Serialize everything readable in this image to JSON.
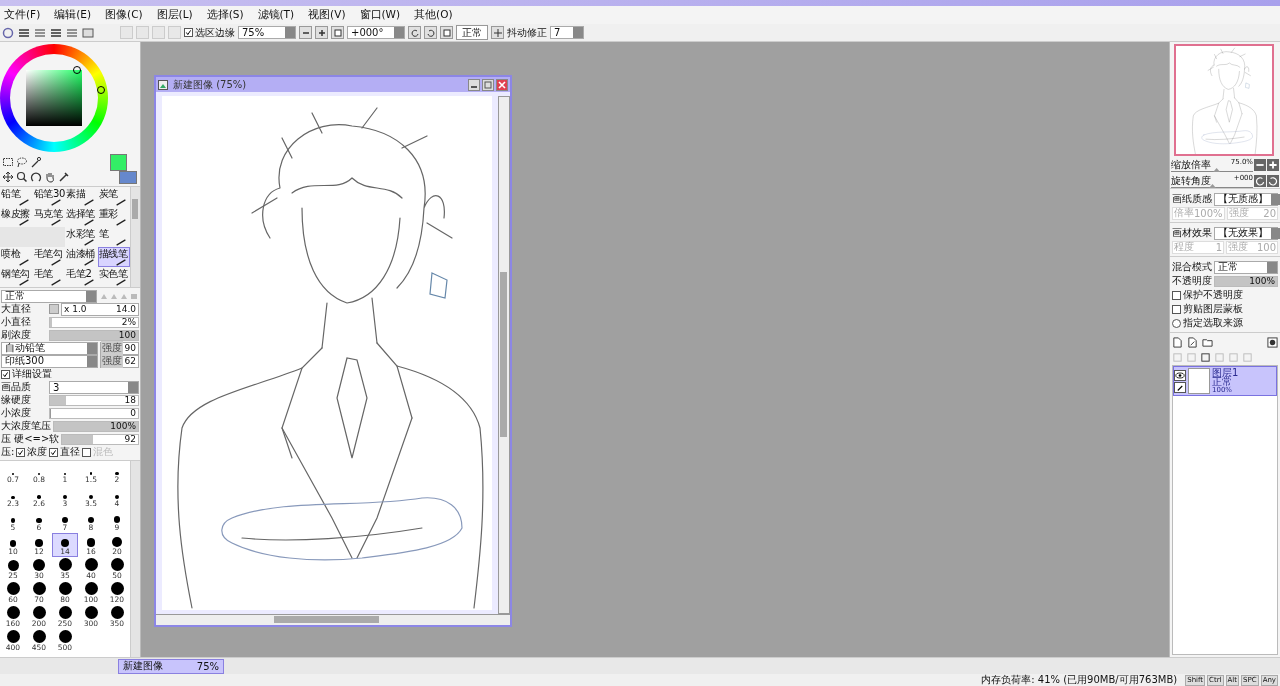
{
  "menu": [
    "文件(F)",
    "编辑(E)",
    "图像(C)",
    "图层(L)",
    "选择(S)",
    "滤镜(T)",
    "视图(V)",
    "窗口(W)",
    "其他(O)"
  ],
  "toolbar": {
    "selection_edge": {
      "label": "选区边缘",
      "checked": true
    },
    "zoom": "75%",
    "rotation": "+000°",
    "blend_mode": "正常",
    "stabilizer": {
      "label": "抖动修正",
      "value": "7"
    }
  },
  "swatches": [
    {
      "kind": "foreground",
      "color": "#33ee66"
    },
    {
      "kind": "background",
      "color": "#6688cc"
    }
  ],
  "brushes": [
    {
      "kind": "tool",
      "label": "铅笔",
      "selected": false
    },
    {
      "kind": "tool",
      "label": "铅笔30",
      "selected": false
    },
    {
      "kind": "tool",
      "label": "素描",
      "selected": false
    },
    {
      "kind": "tool",
      "label": "炭笔",
      "selected": false
    },
    {
      "kind": "tool",
      "label": "橡皮擦",
      "selected": false
    },
    {
      "kind": "tool",
      "label": "马克笔",
      "selected": false
    },
    {
      "kind": "tool",
      "label": "选择笔",
      "selected": false
    },
    {
      "kind": "tool",
      "label": "重彩",
      "selected": false
    },
    {
      "kind": "empty"
    },
    {
      "kind": "empty"
    },
    {
      "kind": "tool",
      "label": "水彩笔",
      "selected": false
    },
    {
      "kind": "tool",
      "label": "笔",
      "selected": false
    },
    {
      "kind": "tool",
      "label": "喷枪",
      "selected": false
    },
    {
      "kind": "tool",
      "label": "毛笔勾",
      "selected": false
    },
    {
      "kind": "tool",
      "label": "油漆桶",
      "selected": false
    },
    {
      "kind": "tool",
      "label": "描线笔",
      "selected": true
    },
    {
      "kind": "tool",
      "label": "钢笔勾",
      "selected": false
    },
    {
      "kind": "tool",
      "label": "毛笔",
      "selected": false
    },
    {
      "kind": "tool",
      "label": "毛笔2",
      "selected": false
    },
    {
      "kind": "tool",
      "label": "实色笔",
      "selected": false
    }
  ],
  "brush_settings": {
    "mode": "正常",
    "rows": [
      {
        "kind": "size",
        "label": "大直径",
        "multiplier": "x 1.0",
        "value": "14.0"
      },
      {
        "kind": "slider",
        "label": "小直径",
        "value": "2%",
        "level": 0.02
      },
      {
        "kind": "slider",
        "label": "刷浓度",
        "value": "100",
        "level": 1
      },
      {
        "kind": "texture",
        "value": "自动铅笔",
        "strength_label": "强度",
        "strength": "90"
      },
      {
        "kind": "texture",
        "value": "印纸300",
        "strength_label": "强度",
        "strength": "62"
      },
      {
        "kind": "check",
        "label": "详细设置",
        "checked": true
      },
      {
        "kind": "select",
        "label": "画品质",
        "value": "3"
      },
      {
        "kind": "slider",
        "label": "缘硬度",
        "value": "18",
        "level": 0.18
      },
      {
        "kind": "slider",
        "label": "小浓度",
        "value": "0",
        "level": 0
      },
      {
        "kind": "slider",
        "label": "大浓度笔压",
        "value": "100%",
        "level": 1
      },
      {
        "kind": "slider",
        "label": "压 硬<=>软",
        "value": "92",
        "level": 0.4
      },
      {
        "kind": "pressure",
        "label": "压:",
        "options": [
          {
            "label": "浓度",
            "checked": true,
            "disabled": false
          },
          {
            "label": "直径",
            "checked": true,
            "disabled": false
          },
          {
            "label": "混色",
            "checked": false,
            "disabled": true
          }
        ]
      }
    ]
  },
  "brush_sizes": [
    {
      "size": "0.7",
      "selected": false
    },
    {
      "size": "0.8",
      "selected": false
    },
    {
      "size": "1",
      "selected": false
    },
    {
      "size": "1.5",
      "selected": false
    },
    {
      "size": "2",
      "selected": false
    },
    {
      "size": "2.3",
      "selected": false
    },
    {
      "size": "2.6",
      "selected": false
    },
    {
      "size": "3",
      "selected": false
    },
    {
      "size": "3.5",
      "selected": false
    },
    {
      "size": "4",
      "selected": false
    },
    {
      "size": "5",
      "selected": false
    },
    {
      "size": "6",
      "selected": false
    },
    {
      "size": "7",
      "selected": false
    },
    {
      "size": "8",
      "selected": false
    },
    {
      "size": "9",
      "selected": false
    },
    {
      "size": "10",
      "selected": false
    },
    {
      "size": "12",
      "selected": false
    },
    {
      "size": "14",
      "selected": true
    },
    {
      "size": "16",
      "selected": false
    },
    {
      "size": "20",
      "selected": false
    },
    {
      "size": "25",
      "selected": false
    },
    {
      "size": "30",
      "selected": false
    },
    {
      "size": "35",
      "selected": false
    },
    {
      "size": "40",
      "selected": false
    },
    {
      "size": "50",
      "selected": false
    },
    {
      "size": "60",
      "selected": false
    },
    {
      "size": "70",
      "selected": false
    },
    {
      "size": "80",
      "selected": false
    },
    {
      "size": "100",
      "selected": false
    },
    {
      "size": "120",
      "selected": false
    },
    {
      "size": "160",
      "selected": false
    },
    {
      "size": "200",
      "selected": false
    },
    {
      "size": "250",
      "selected": false
    },
    {
      "size": "300",
      "selected": false
    },
    {
      "size": "350",
      "selected": false
    },
    {
      "size": "400",
      "selected": false
    },
    {
      "size": "450",
      "selected": false
    },
    {
      "size": "500",
      "selected": false
    }
  ],
  "document": {
    "title": "新建图像 (75%)"
  },
  "navigator": {
    "zoom": {
      "label": "缩放倍率",
      "value": "75.0%",
      "level": 0.55
    },
    "rotation": {
      "label": "旋转角度",
      "value": "+000",
      "level": 0.5
    }
  },
  "paper_texture": {
    "label": "画纸质感",
    "value": "【无质感】",
    "params": [
      {
        "label": "倍率",
        "value": "100%",
        "disabled": true
      },
      {
        "label": "强度",
        "value": "20",
        "disabled": true
      }
    ]
  },
  "material_effect": {
    "label": "画材效果",
    "value": "【无效果】",
    "params": [
      {
        "label": "程度",
        "value": "1",
        "disabled": true
      },
      {
        "label": "强度",
        "value": "100",
        "disabled": true
      }
    ]
  },
  "layer_props": {
    "blend_label": "混合模式",
    "blend": "正常",
    "opacity_label": "不透明度",
    "opacity": "100%",
    "level": 1,
    "options": [
      {
        "kind": "checkbox",
        "label": "保护不透明度",
        "checked": false
      },
      {
        "kind": "checkbox",
        "label": "剪贴图层蒙板",
        "checked": false
      },
      {
        "kind": "radio",
        "label": "指定选取来源",
        "checked": false
      }
    ]
  },
  "layers": [
    {
      "name": "图层1",
      "mode": "正常",
      "opacity": "100%",
      "visible": true,
      "selected": true
    }
  ],
  "tabs": [
    {
      "label": "新建图像",
      "zoom": "75%",
      "selected": true
    }
  ],
  "status": {
    "memory": "内存负荷率: 41% (已用90MB/可用763MB)",
    "keys": [
      "Shift",
      "Ctrl",
      "Alt",
      "SPC",
      "Any"
    ]
  }
}
